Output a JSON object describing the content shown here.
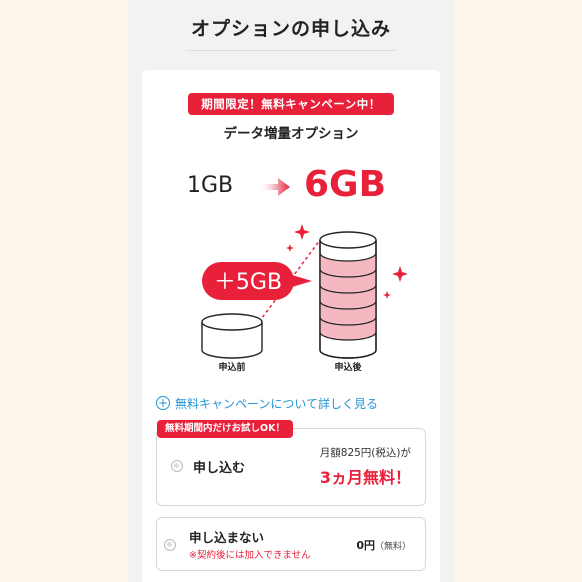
{
  "page": {
    "title": "オプションの申し込み"
  },
  "card": {
    "campaign_badge": "期間限定！無料キャンペーン中！",
    "option_name": "データ増量オプション",
    "before_gb": "1GB",
    "after_gb": "6GB",
    "increase_label": "＋5GB",
    "label_before": "申込前",
    "label_after": "申込後",
    "campaign_link": "無料キャンペーンについて詳しく見る"
  },
  "options": {
    "apply": {
      "tag": "無料期間内だけお試しOK！",
      "label": "申し込む",
      "price": "月額825円(税込)が",
      "free_text": "3ヵ月無料！"
    },
    "decline": {
      "label": "申し込まない",
      "note": "※契約後には加入できません",
      "price": "0円",
      "price_suffix": "（無料）"
    }
  },
  "colors": {
    "accent_red": "#e8203a",
    "link_blue": "#2596d6",
    "background": "#fdf6ea",
    "panel": "#f2f2f2"
  },
  "icons": {
    "arrow": "arrow-right-icon",
    "plus": "plus-circle-icon",
    "sparkle": "sparkle-icon"
  }
}
